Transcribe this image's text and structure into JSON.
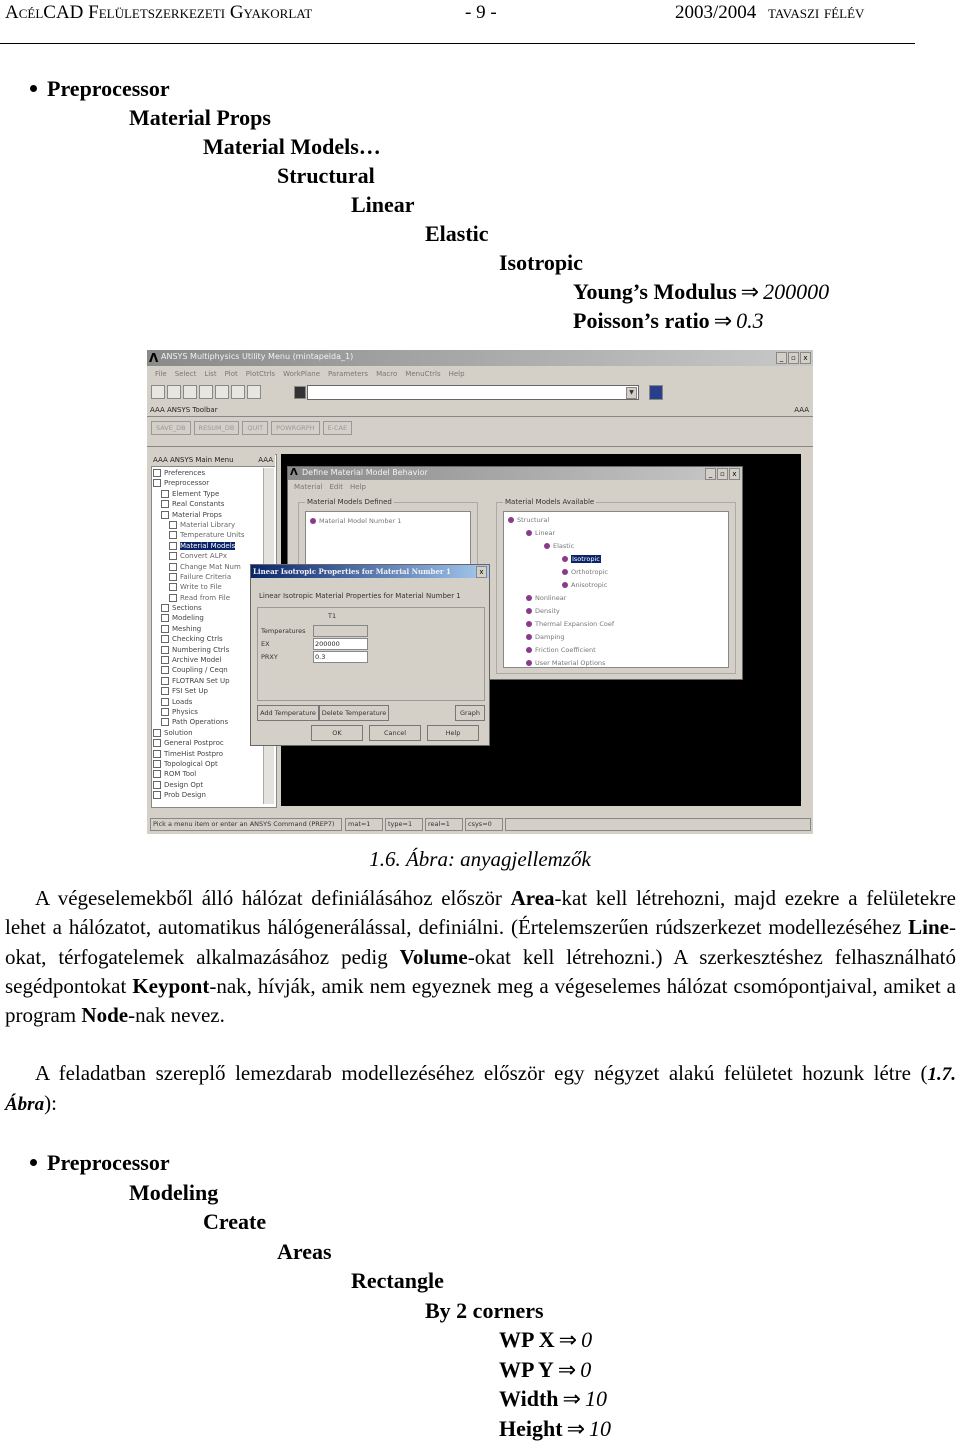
{
  "header": {
    "left": "AcélCAD Felületszerkezeti Gyakorlat",
    "center": "- 9 -",
    "right_year": "2003/2004",
    "right_sem": "tavaszi félév"
  },
  "tree1": [
    {
      "label": "Preprocessor",
      "bullet": true
    },
    {
      "label": "Material Props"
    },
    {
      "label": "Material Models…"
    },
    {
      "label": "Structural"
    },
    {
      "label": "Linear"
    },
    {
      "label": "Elastic"
    },
    {
      "label": "Isotropic"
    },
    {
      "label": "Young’s Modulus",
      "arrow": "⇒",
      "value": "200000"
    },
    {
      "label": "Poisson’s ratio",
      "arrow": "⇒",
      "value": "0.3"
    }
  ],
  "ansys": {
    "window_title": "ANSYS Multiphysics Utility Menu (mintapelda_1)",
    "logo": "Λ",
    "window_buttons": [
      "_",
      "▫",
      "x"
    ],
    "menu": [
      "File",
      "Select",
      "List",
      "Plot",
      "PlotCtrls",
      "WorkPlane",
      "Parameters",
      "Macro",
      "MenuCtrls",
      "Help"
    ],
    "toolbar_label": "AAA ANSYS Toolbar",
    "toolbar_aaa": "AAA",
    "toolbar_buttons": [
      "SAVE_DB",
      "RESUM_DB",
      "QUIT",
      "POWRGRPH",
      "E-CAE"
    ],
    "command_input": "",
    "main_menu_header": "AAA ANSYS Main Menu",
    "main_menu_aaa": "AAA",
    "main_menu": [
      {
        "label": "Preferences",
        "level": 0
      },
      {
        "label": "Preprocessor",
        "level": 0
      },
      {
        "label": "Element Type",
        "level": 1
      },
      {
        "label": "Real Constants",
        "level": 1
      },
      {
        "label": "Material Props",
        "level": 1
      },
      {
        "label": "Material Library",
        "level": 2
      },
      {
        "label": "Temperature Units",
        "level": 2
      },
      {
        "label": "Material Models",
        "level": 2,
        "selected": true
      },
      {
        "label": "Convert ALPx",
        "level": 2
      },
      {
        "label": "Change Mat Num",
        "level": 2
      },
      {
        "label": "Failure Criteria",
        "level": 2
      },
      {
        "label": "Write to File",
        "level": 2
      },
      {
        "label": "Read from File",
        "level": 2
      },
      {
        "label": "Sections",
        "level": 1
      },
      {
        "label": "Modeling",
        "level": 1
      },
      {
        "label": "Meshing",
        "level": 1
      },
      {
        "label": "Checking Ctrls",
        "level": 1
      },
      {
        "label": "Numbering Ctrls",
        "level": 1
      },
      {
        "label": "Archive Model",
        "level": 1
      },
      {
        "label": "Coupling / Ceqn",
        "level": 1
      },
      {
        "label": "FLOTRAN Set Up",
        "level": 1
      },
      {
        "label": "FSI Set Up",
        "level": 1
      },
      {
        "label": "Loads",
        "level": 1
      },
      {
        "label": "Physics",
        "level": 1
      },
      {
        "label": "Path Operations",
        "level": 1
      },
      {
        "label": "Solution",
        "level": 0
      },
      {
        "label": "General Postproc",
        "level": 0
      },
      {
        "label": "TimeHist Postpro",
        "level": 0
      },
      {
        "label": "Topological Opt",
        "level": 0
      },
      {
        "label": "ROM Tool",
        "level": 0
      },
      {
        "label": "Design Opt",
        "level": 0
      },
      {
        "label": "Prob Design",
        "level": 0
      }
    ],
    "status": {
      "prompt": "Pick a menu item or enter an ANSYS Command (PREP7)",
      "mat": "mat=1",
      "type": "type=1",
      "real": "real=1",
      "csys": "csys=0"
    },
    "define_dialog": {
      "title": "Define Material Model Behavior",
      "menu": [
        "Material",
        "Edit",
        "Help"
      ],
      "defined_label": "Material Models Defined",
      "defined_items": [
        "Material Model Number 1"
      ],
      "available_label": "Material Models Available",
      "available_items": [
        {
          "label": "Structural",
          "level": 0
        },
        {
          "label": "Linear",
          "level": 1
        },
        {
          "label": "Elastic",
          "level": 2
        },
        {
          "label": "Isotropic",
          "level": 3,
          "selected": true
        },
        {
          "label": "Orthotropic",
          "level": 3
        },
        {
          "label": "Anisotropic",
          "level": 3
        },
        {
          "label": "Nonlinear",
          "level": 1
        },
        {
          "label": "Density",
          "level": 1
        },
        {
          "label": "Thermal Expansion Coef",
          "level": 1
        },
        {
          "label": "Damping",
          "level": 1
        },
        {
          "label": "Friction Coefficient",
          "level": 1
        },
        {
          "label": "User Material Options",
          "level": 1
        }
      ]
    },
    "iso_dialog": {
      "title": "Linear Isotropic Properties for Material Number 1",
      "subtitle": "Linear Isotropic Material Properties for Material Number 1",
      "column": "T1",
      "rows": [
        {
          "label": "Temperatures",
          "value": ""
        },
        {
          "label": "EX",
          "value": "200000"
        },
        {
          "label": "PRXY",
          "value": "0.3"
        }
      ],
      "buttons": {
        "add_temp": "Add Temperature",
        "delete_temp": "Delete Temperature",
        "graph": "Graph",
        "ok": "OK",
        "cancel": "Cancel",
        "help": "Help"
      }
    }
  },
  "caption": "1.6. Ábra: anyagjellemzők",
  "paragraph1": [
    {
      "t": "A végeselemekből álló hálózat definiálásához először "
    },
    {
      "t": "Area",
      "b": true
    },
    {
      "t": "-kat kell létrehozni, majd ezekre a felületekre lehet a hálózatot, automatikus hálógenerálással, definiálni. (Értelemszerűen rúdszerkezet modellezéséhez "
    },
    {
      "t": "Line",
      "b": true
    },
    {
      "t": "-okat, térfogatelemek alkalmazásához pedig "
    },
    {
      "t": "Volume",
      "b": true
    },
    {
      "t": "-okat kell létrehozni.) A szerkesztéshez felhasználható segédpontokat "
    },
    {
      "t": "Keypont",
      "b": true
    },
    {
      "t": "-nak, hívják, amik nem egyeznek meg a végeselemes hálózat csomópontjaival, amiket a program "
    },
    {
      "t": "Node",
      "b": true
    },
    {
      "t": "-nak nevez."
    }
  ],
  "paragraph2": [
    {
      "t": "A feladatban szereplő lemezdarab modellezéséhez először egy négyzet alakú felületet hozunk létre ("
    },
    {
      "t": "1.7. Ábra",
      "bi": true
    },
    {
      "t": "):"
    }
  ],
  "tree2": [
    {
      "label": "Preprocessor",
      "bullet": true
    },
    {
      "label": "Modeling"
    },
    {
      "label": "Create"
    },
    {
      "label": "Areas"
    },
    {
      "label": "Rectangle"
    },
    {
      "label": "By 2 corners"
    },
    {
      "label": "WP X",
      "arrow": "⇒",
      "value": "0"
    },
    {
      "label": "WP Y",
      "arrow": "⇒",
      "value": "0"
    },
    {
      "label": "Width",
      "arrow": "⇒",
      "value": "10"
    },
    {
      "label": "Height",
      "arrow": "⇒",
      "value": "10"
    }
  ]
}
